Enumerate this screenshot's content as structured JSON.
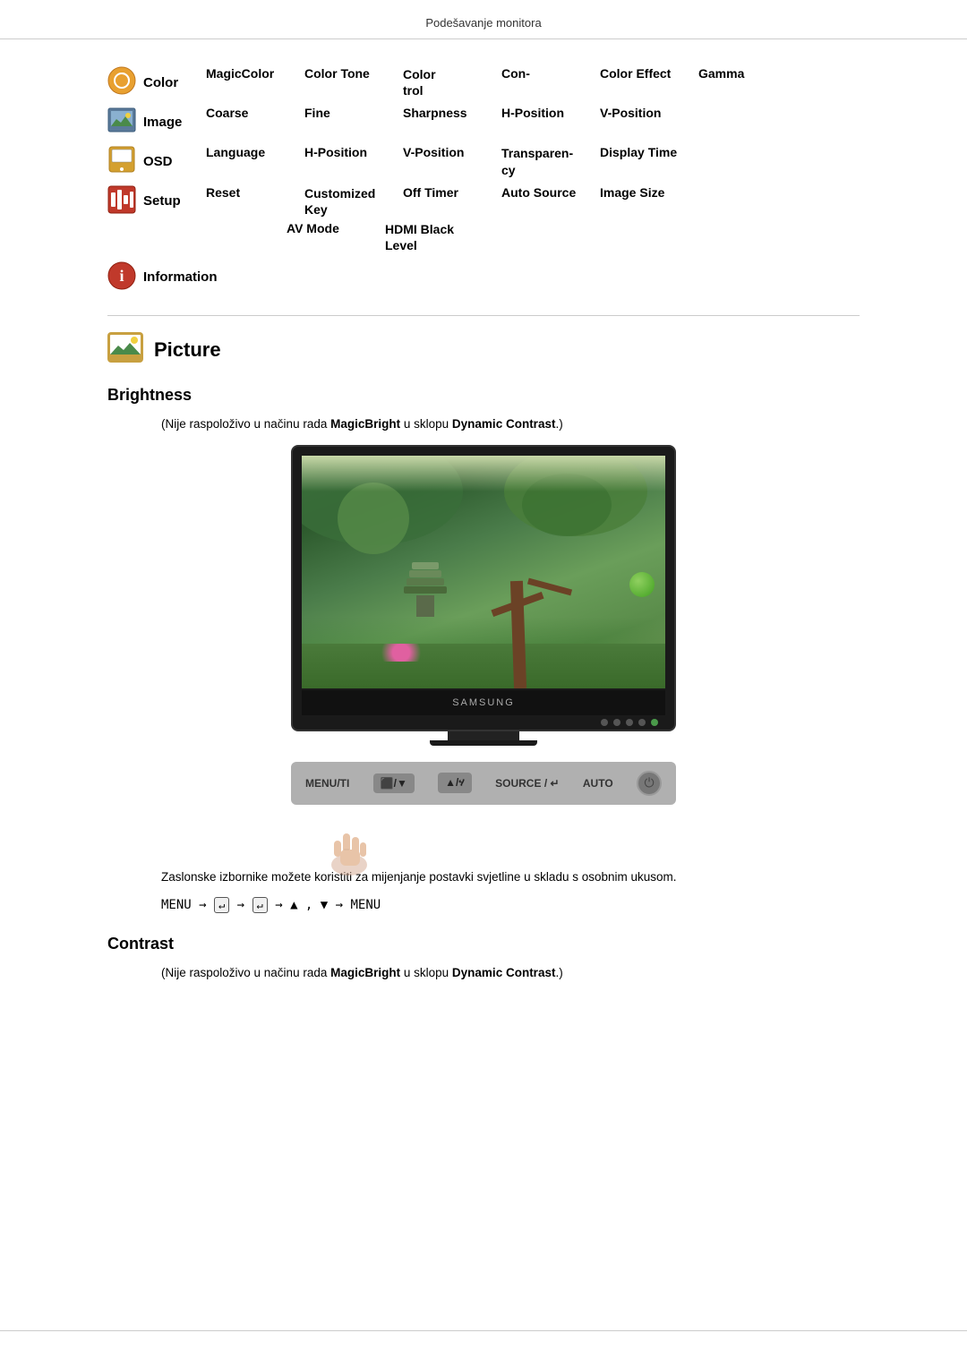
{
  "header": {
    "title": "Podešavanje monitora"
  },
  "nav": {
    "rows": [
      {
        "id": "color",
        "label": "Color",
        "icon": "color-icon",
        "items": [
          "MagicColor",
          "Color Tone",
          "Color\ntrol",
          "Con-",
          "Color Effect",
          "Gamma"
        ]
      },
      {
        "id": "image",
        "label": "Image",
        "icon": "image-icon",
        "items": [
          "Coarse",
          "Fine",
          "Sharpness",
          "H-Position",
          "V-Position"
        ]
      },
      {
        "id": "osd",
        "label": "OSD",
        "icon": "osd-icon",
        "items": [
          "Language",
          "H-Position",
          "V-Position",
          "Transparen-\ncy",
          "Display Time"
        ]
      },
      {
        "id": "setup",
        "label": "Setup",
        "icon": "setup-icon",
        "items": [
          "Reset",
          "Customized\nKey",
          "Off Timer",
          "Auto Source",
          "Image Size"
        ]
      },
      {
        "id": "setup2",
        "label": "",
        "icon": "",
        "items": [
          "AV Mode",
          "HDMI Black\nLevel"
        ]
      },
      {
        "id": "information",
        "label": "Information",
        "icon": "info-icon",
        "items": []
      }
    ]
  },
  "picture_section": {
    "title": "Picture",
    "icon_label": "picture-section-icon"
  },
  "brightness": {
    "title": "Brightness",
    "note": "(Nije raspoloživo u načinu rada MagicBright u sklopu Dynamic Contrast.)",
    "note_bold_1": "MagicBright",
    "note_bold_2": "Dynamic Contrast",
    "description": "Zaslonske izbornike možete koristiti za mijenjanje postavki svjetline u skladu s osobnim ukusom.",
    "menu_formula": "MENU → ↵ → ↵ → ▲ , ▼ → MENU"
  },
  "contrast": {
    "title": "Contrast",
    "note": "(Nije raspoloživo u načinu rada MagicBright u sklopu Dynamic Contrast.)",
    "note_bold_1": "MagicBright",
    "note_bold_2": "Dynamic Contrast"
  },
  "controls": {
    "menu_label": "MENU/TI",
    "btn1_label": "⬛/▼",
    "btn2_label": "▲/ሃ",
    "btn3_label": "SOURCE / ↵",
    "btn4_label": "AUTO",
    "power_label": "⏻"
  },
  "monitor_brand": "SAMSUNG",
  "colors": {
    "color_icon_bg": "#e8a030",
    "image_icon_bg": "#5a7a9a",
    "osd_icon_bg": "#d4a030",
    "setup_icon_bg": "#c0392b",
    "info_icon_bg": "#c0392b",
    "picture_icon_bg": "#c8a040"
  }
}
